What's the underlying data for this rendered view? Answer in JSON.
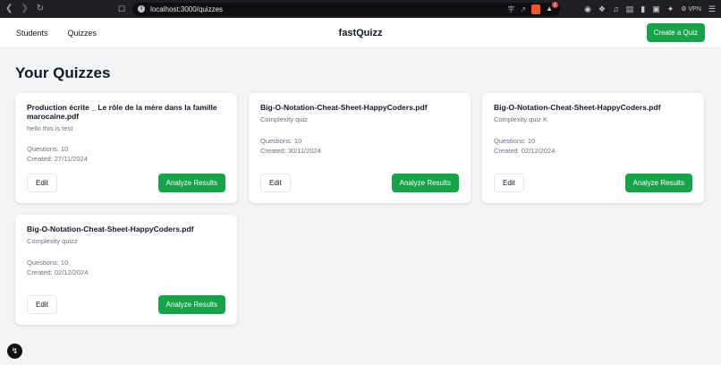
{
  "browser": {
    "url": "localhost:3000/quizzes",
    "extension_badge": "1",
    "vpn_label": "VPN"
  },
  "header": {
    "nav": [
      {
        "label": "Students"
      },
      {
        "label": "Quizzes"
      }
    ],
    "brand": "fastQuizz",
    "create_label": "Create a Quiz"
  },
  "main": {
    "title": "Your Quizzes",
    "quizzes": [
      {
        "title": "Production écrite _ Le rôle de la mère dans la famille marocaine.pdf",
        "description": "hello this is test",
        "questions": "Questions: 10",
        "created": "Created: 27/11/2024",
        "edit_label": "Edit",
        "analyze_label": "Analyze Results"
      },
      {
        "title": "Big-O-Notation-Cheat-Sheet-HappyCoders.pdf",
        "description": "Complexity quiz",
        "questions": "Questions: 10",
        "created": "Created: 30/11/2024",
        "edit_label": "Edit",
        "analyze_label": "Analyze Results"
      },
      {
        "title": "Big-O-Notation-Cheat-Sheet-HappyCoders.pdf",
        "description": "Complexity quiz K",
        "questions": "Questions: 10",
        "created": "Created: 02/12/2024",
        "edit_label": "Edit",
        "analyze_label": "Analyze Results"
      },
      {
        "title": "Big-O-Notation-Cheat-Sheet-HappyCoders.pdf",
        "description": "Complexity quizz",
        "questions": "Questions: 10",
        "created": "Created: 02/12/2024",
        "edit_label": "Edit",
        "analyze_label": "Analyze Results"
      }
    ]
  },
  "colors": {
    "accent": "#16a34a",
    "background": "#f3f4f6",
    "card": "#ffffff"
  },
  "icons": {
    "dev_tools": "lightning-icon"
  }
}
